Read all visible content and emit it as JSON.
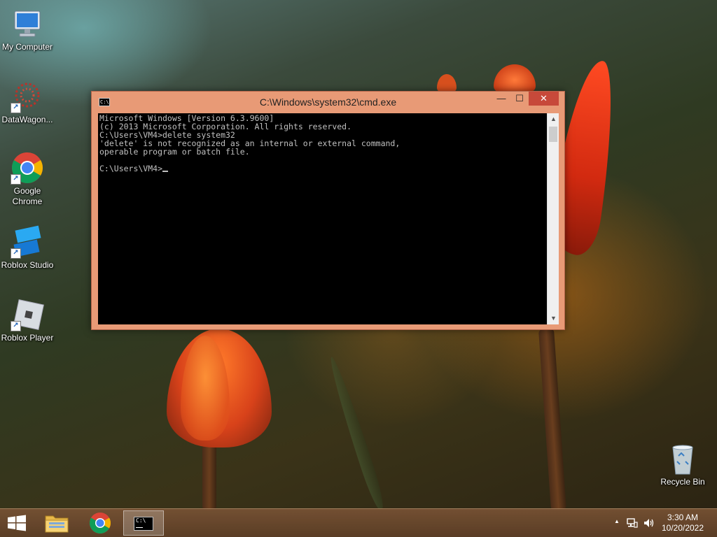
{
  "desktop": {
    "icons": [
      {
        "label": "My Computer",
        "icon": "computer-icon"
      },
      {
        "label": "DataWagon...",
        "icon": "datawagon-icon"
      },
      {
        "label": "Google Chrome",
        "icon": "chrome-icon"
      },
      {
        "label": "Roblox Studio",
        "icon": "roblox-studio-icon"
      },
      {
        "label": "Roblox Player",
        "icon": "roblox-player-icon"
      },
      {
        "label": "Recycle Bin",
        "icon": "recycle-bin-icon"
      }
    ]
  },
  "cmd_window": {
    "title": "C:\\Windows\\system32\\cmd.exe",
    "icon_text": "C:\\",
    "buttons": {
      "minimize": "—",
      "maximize": "☐",
      "close": "✕"
    },
    "lines": [
      "Microsoft Windows [Version 6.3.9600]",
      "(c) 2013 Microsoft Corporation. All rights reserved.",
      "C:\\Users\\VM4>delete system32",
      "'delete' is not recognized as an internal or external command,",
      "operable program or batch file.",
      "",
      "C:\\Users\\VM4>"
    ],
    "scrollbar": {
      "up": "▲",
      "down": "▼"
    }
  },
  "taskbar": {
    "items": [
      {
        "name": "start",
        "icon": "windows-logo-icon"
      },
      {
        "name": "file-explorer",
        "icon": "folder-icon"
      },
      {
        "name": "chrome",
        "icon": "chrome-icon"
      },
      {
        "name": "cmd",
        "icon": "cmd-icon",
        "active": true,
        "icon_text": "C:\\"
      }
    ],
    "tray": {
      "show_hidden": "▲",
      "clock_time": "3:30 AM",
      "clock_date": "10/20/2022"
    }
  },
  "colors": {
    "window_frame": "#e89a76",
    "close_button": "#c7493a",
    "console_bg": "#000000",
    "console_text": "#c0c0c0",
    "taskbar": "#785234"
  }
}
